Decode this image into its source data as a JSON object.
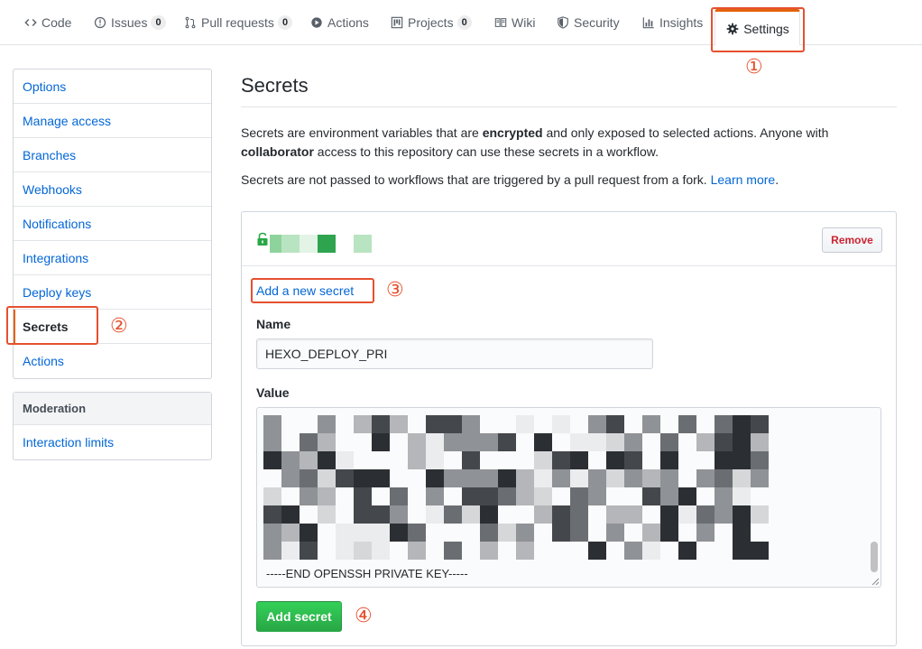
{
  "nav": {
    "tabs": [
      {
        "label": "Code",
        "icon": "code-icon"
      },
      {
        "label": "Issues",
        "icon": "issue-opened-icon",
        "count": "0"
      },
      {
        "label": "Pull requests",
        "icon": "git-pull-request-icon",
        "count": "0"
      },
      {
        "label": "Actions",
        "icon": "play-icon"
      },
      {
        "label": "Projects",
        "icon": "project-icon",
        "count": "0"
      },
      {
        "label": "Wiki",
        "icon": "book-icon"
      },
      {
        "label": "Security",
        "icon": "shield-icon"
      },
      {
        "label": "Insights",
        "icon": "graph-icon"
      },
      {
        "label": "Settings",
        "icon": "gear-icon",
        "selected": true
      }
    ]
  },
  "annotations": [
    "①",
    "②",
    "③",
    "④"
  ],
  "sidebar": {
    "items": [
      "Options",
      "Manage access",
      "Branches",
      "Webhooks",
      "Notifications",
      "Integrations",
      "Deploy keys",
      "Secrets",
      "Actions"
    ],
    "selected": "Secrets",
    "moderation": {
      "heading": "Moderation",
      "items": [
        "Interaction limits"
      ]
    }
  },
  "main": {
    "title": "Secrets",
    "description_1": {
      "part1": "Secrets are environment variables that are ",
      "bold1": "encrypted",
      "part2": " and only exposed to selected actions. Anyone with ",
      "bold2": "collaborator",
      "part3": " access to this repository can use these secrets in a workflow."
    },
    "description_2": {
      "text": "Secrets are not passed to workflows that are triggered by a pull request from a fork. ",
      "link": "Learn more",
      "end": "."
    },
    "secret_row": {
      "remove_label": "Remove"
    },
    "form": {
      "add_link": "Add a new secret",
      "name_label": "Name",
      "name_value": "HEXO_DEPLOY_PRI",
      "value_label": "Value",
      "value_visible_tail": "-----END OPENSSH PRIVATE KEY-----",
      "submit_label": "Add secret"
    }
  },
  "colors": {
    "accent_orange": "#e36209",
    "annotation_red": "#e5502f",
    "link_blue": "#0366d6",
    "danger_red": "#cb2431",
    "primary_green": "#28a745"
  }
}
